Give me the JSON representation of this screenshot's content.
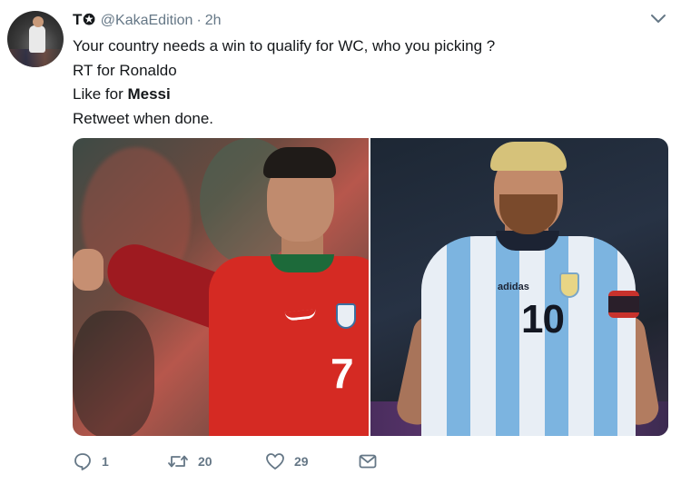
{
  "author": {
    "display_name": "T",
    "badge": "✪",
    "handle": "@KakaEdition",
    "separator": "·",
    "time": "2h"
  },
  "tweet": {
    "line1": "Your country needs a win to qualify for WC, who you picking ?",
    "line2": "RT for Ronaldo",
    "line3_prefix": "Like for ",
    "line3_bold": "Messi",
    "line4": "Retweet when done."
  },
  "media": {
    "left_shirt_number": "7",
    "right_shirt_number": "10",
    "right_brand": "adidas"
  },
  "actions": {
    "reply_count": "1",
    "retweet_count": "20",
    "like_count": "29"
  },
  "icons": {
    "caret": "chevron-down-icon",
    "reply": "reply-icon",
    "retweet": "retweet-icon",
    "like": "heart-icon",
    "dm": "envelope-icon"
  },
  "colors": {
    "text": "#14171a",
    "muted": "#657786"
  }
}
